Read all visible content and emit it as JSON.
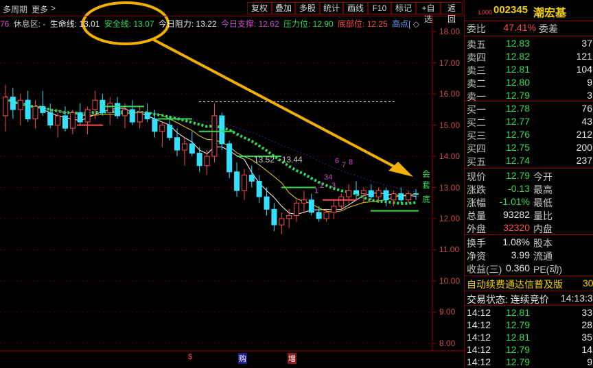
{
  "toolbar": {
    "period_label": "多周期",
    "more_label": "更多",
    "more_arrow": ">",
    "buttons": [
      "复权",
      "叠加",
      "多股",
      "统计",
      "画线",
      "F10",
      "标记",
      "+自选",
      "返回"
    ]
  },
  "indicators": {
    "prefix_value": "76",
    "rest_zone_label": "休息区: -",
    "lifeline_label": "生命线:",
    "lifeline_value": "13.01",
    "safety_label": "安全线:",
    "safety_value": "13.07",
    "resistance_label": "今日阻力:",
    "resistance_value": "13.22",
    "support_label": "今日支撑:",
    "support_value": "12.62",
    "pressure_label": "压力位:",
    "pressure_value": "12.90",
    "bottom_label": "底部位:",
    "bottom_value": "12.25",
    "high_label": "高点[",
    "diamond_icon": "◇"
  },
  "chart_data": {
    "type": "candlestick",
    "y_axis_ticks": [
      "18.00",
      "17.00",
      "16.00",
      "15.00",
      "14.00",
      "13.00",
      "12.00",
      "11.00",
      "10.00",
      "9.00",
      "8.00"
    ],
    "ylim": [
      7.8,
      18.4
    ],
    "annotations": {
      "range_label": "13.52 - 13.44",
      "right_labels": [
        "会",
        "套",
        "底"
      ],
      "small_numbers": [
        "6",
        "7",
        "8",
        "34",
        "2",
        "1",
        "3"
      ],
      "bottom_markers": [
        "$",
        "购",
        "增"
      ]
    },
    "candles": [
      {
        "o": 15.3,
        "h": 16.3,
        "l": 14.8,
        "c": 15.9
      },
      {
        "o": 15.9,
        "h": 16.2,
        "l": 15.2,
        "c": 15.5
      },
      {
        "o": 15.5,
        "h": 16.0,
        "l": 15.0,
        "c": 15.8
      },
      {
        "o": 15.8,
        "h": 16.1,
        "l": 15.1,
        "c": 15.2
      },
      {
        "o": 15.2,
        "h": 15.8,
        "l": 14.9,
        "c": 15.6
      },
      {
        "o": 15.6,
        "h": 16.1,
        "l": 15.3,
        "c": 15.4
      },
      {
        "o": 15.4,
        "h": 15.7,
        "l": 14.9,
        "c": 15.0
      },
      {
        "o": 15.0,
        "h": 15.4,
        "l": 14.6,
        "c": 15.3
      },
      {
        "o": 15.3,
        "h": 15.6,
        "l": 14.8,
        "c": 14.9
      },
      {
        "o": 14.9,
        "h": 15.5,
        "l": 14.7,
        "c": 15.4
      },
      {
        "o": 15.4,
        "h": 15.7,
        "l": 15.0,
        "c": 15.1
      },
      {
        "o": 15.1,
        "h": 15.6,
        "l": 14.7,
        "c": 15.5
      },
      {
        "o": 15.5,
        "h": 16.1,
        "l": 15.2,
        "c": 15.8
      },
      {
        "o": 15.8,
        "h": 16.0,
        "l": 15.3,
        "c": 15.4
      },
      {
        "o": 15.4,
        "h": 15.9,
        "l": 15.0,
        "c": 15.7
      },
      {
        "o": 15.7,
        "h": 15.9,
        "l": 15.2,
        "c": 15.3
      },
      {
        "o": 15.3,
        "h": 15.7,
        "l": 14.9,
        "c": 15.5
      },
      {
        "o": 15.5,
        "h": 15.8,
        "l": 15.0,
        "c": 15.1
      },
      {
        "o": 15.1,
        "h": 15.6,
        "l": 14.9,
        "c": 15.4
      },
      {
        "o": 15.4,
        "h": 15.7,
        "l": 15.1,
        "c": 15.2
      },
      {
        "o": 15.2,
        "h": 15.5,
        "l": 14.6,
        "c": 14.8
      },
      {
        "o": 14.8,
        "h": 15.1,
        "l": 14.3,
        "c": 15.0
      },
      {
        "o": 15.0,
        "h": 15.3,
        "l": 14.5,
        "c": 14.6
      },
      {
        "o": 14.6,
        "h": 14.9,
        "l": 14.0,
        "c": 14.2
      },
      {
        "o": 14.2,
        "h": 14.6,
        "l": 13.7,
        "c": 14.4
      },
      {
        "o": 14.4,
        "h": 14.8,
        "l": 14.0,
        "c": 14.1
      },
      {
        "o": 14.1,
        "h": 14.3,
        "l": 13.5,
        "c": 13.7
      },
      {
        "o": 13.7,
        "h": 14.2,
        "l": 13.4,
        "c": 14.0
      },
      {
        "o": 14.0,
        "h": 15.7,
        "l": 13.8,
        "c": 15.3
      },
      {
        "o": 15.3,
        "h": 15.4,
        "l": 14.2,
        "c": 14.4
      },
      {
        "o": 14.4,
        "h": 14.5,
        "l": 13.3,
        "c": 13.5
      },
      {
        "o": 13.5,
        "h": 13.8,
        "l": 12.7,
        "c": 12.9
      },
      {
        "o": 12.9,
        "h": 13.6,
        "l": 12.6,
        "c": 13.4
      },
      {
        "o": 13.4,
        "h": 13.7,
        "l": 13.0,
        "c": 13.2
      },
      {
        "o": 13.2,
        "h": 13.4,
        "l": 12.5,
        "c": 12.7
      },
      {
        "o": 12.7,
        "h": 13.0,
        "l": 12.1,
        "c": 12.3
      },
      {
        "o": 12.3,
        "h": 12.5,
        "l": 11.6,
        "c": 11.8
      },
      {
        "o": 11.8,
        "h": 12.2,
        "l": 11.5,
        "c": 12.0
      },
      {
        "o": 12.0,
        "h": 12.3,
        "l": 11.7,
        "c": 12.1
      },
      {
        "o": 12.1,
        "h": 12.6,
        "l": 11.9,
        "c": 12.5
      },
      {
        "o": 12.5,
        "h": 12.9,
        "l": 12.2,
        "c": 12.6
      },
      {
        "o": 12.6,
        "h": 12.8,
        "l": 12.1,
        "c": 12.2
      },
      {
        "o": 12.2,
        "h": 12.4,
        "l": 11.9,
        "c": 12.0
      },
      {
        "o": 12.0,
        "h": 12.3,
        "l": 11.9,
        "c": 12.2
      },
      {
        "o": 12.2,
        "h": 12.6,
        "l": 12.0,
        "c": 12.4
      },
      {
        "o": 12.4,
        "h": 12.8,
        "l": 12.3,
        "c": 12.7
      },
      {
        "o": 12.7,
        "h": 13.1,
        "l": 12.5,
        "c": 12.9
      },
      {
        "o": 12.9,
        "h": 13.2,
        "l": 12.6,
        "c": 12.8
      },
      {
        "o": 12.8,
        "h": 13.0,
        "l": 12.5,
        "c": 12.9
      },
      {
        "o": 12.9,
        "h": 13.1,
        "l": 12.6,
        "c": 12.7
      },
      {
        "o": 12.7,
        "h": 13.0,
        "l": 12.5,
        "c": 12.9
      },
      {
        "o": 12.9,
        "h": 13.0,
        "l": 12.4,
        "c": 12.6
      },
      {
        "o": 12.6,
        "h": 12.9,
        "l": 12.4,
        "c": 12.8
      },
      {
        "o": 12.8,
        "h": 13.0,
        "l": 12.5,
        "c": 12.6
      },
      {
        "o": 12.6,
        "h": 12.9,
        "l": 12.5,
        "c": 12.8
      },
      {
        "o": 12.8,
        "h": 12.95,
        "l": 12.6,
        "c": 12.79
      }
    ]
  },
  "stock": {
    "code": "002345",
    "name": "潮宏基",
    "tag": "L000"
  },
  "order_book": {
    "ratio_label": "委比",
    "ratio_value": "47.41%",
    "diff_label": "委差",
    "asks": [
      {
        "label": "卖五",
        "price": "12.83",
        "volume": "37"
      },
      {
        "label": "卖四",
        "price": "12.82",
        "volume": "121"
      },
      {
        "label": "卖三",
        "price": "12.81",
        "volume": "104"
      },
      {
        "label": "卖二",
        "price": "12.80",
        "volume": "9"
      },
      {
        "label": "卖一",
        "price": "12.79",
        "volume": "3"
      }
    ],
    "bids": [
      {
        "label": "买一",
        "price": "12.78",
        "volume": "76"
      },
      {
        "label": "买二",
        "price": "12.77",
        "volume": "43"
      },
      {
        "label": "买三",
        "price": "12.76",
        "volume": "212"
      },
      {
        "label": "买四",
        "price": "12.75",
        "volume": "200"
      },
      {
        "label": "买五",
        "price": "12.74",
        "volume": "237"
      }
    ]
  },
  "quote": {
    "rows": [
      {
        "l1": "现价",
        "v1": "12.79",
        "l2": "今开",
        "c": "green"
      },
      {
        "l1": "涨跌",
        "v1": "-0.13",
        "l2": "最高",
        "c": "green"
      },
      {
        "l1": "涨幅",
        "v1": "-1.01%",
        "l2": "最低",
        "c": "green"
      },
      {
        "l1": "总量",
        "v1": "93282",
        "l2": "量比",
        "c": "white"
      },
      {
        "l1": "外盘",
        "v1": "32320",
        "l2": "内盘",
        "c": "red"
      }
    ],
    "rows2": [
      {
        "l1": "换手",
        "v1": "1.08%",
        "l2": "股本"
      },
      {
        "l1": "净资",
        "v1": "3.99",
        "l2": "流通"
      },
      {
        "l1": "收益(三)",
        "v1": "0.360",
        "l2": "PE(动)"
      }
    ]
  },
  "banner": {
    "text": "自动续费通达信普及版",
    "suffix": "30"
  },
  "trade_status": {
    "label": "交易状态: 连续竞价",
    "time": "14:13:3"
  },
  "ticks": [
    {
      "time": "14:12",
      "price": "12.81",
      "volume": "33"
    },
    {
      "time": "14:12",
      "price": "12.79",
      "volume": "28"
    },
    {
      "time": "14:12",
      "price": "12.81",
      "volume": "35"
    },
    {
      "time": "14:12",
      "price": "12.79",
      "volume": "14"
    },
    {
      "time": "14:12",
      "price": "12.79",
      "volume": "9"
    }
  ]
}
